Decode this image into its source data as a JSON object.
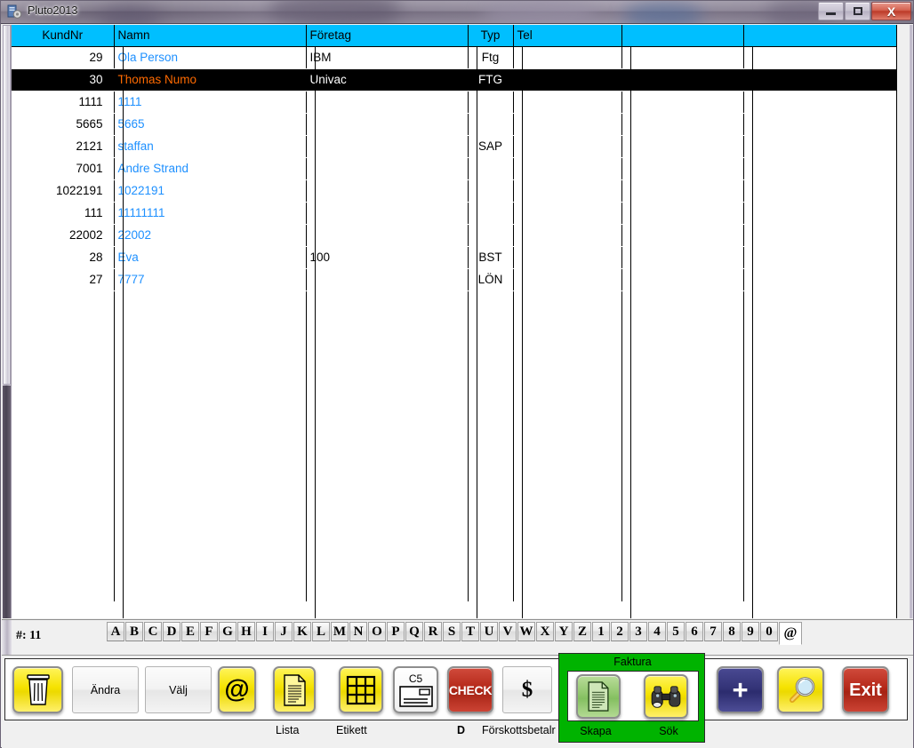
{
  "window": {
    "title": "Pluto2013",
    "icon": "app-icon",
    "controls": {
      "minimize": "minimize-icon",
      "maximize": "maximize-icon",
      "close": "X"
    }
  },
  "colors": {
    "header_blue": "#00bfff",
    "selected_row_bg": "#000000",
    "selected_row_text": "#ff6a00",
    "link_text": "#1e90ff",
    "faktura_green": "#00b300",
    "button_yellow": "#f5e200",
    "button_red": "#b5291a",
    "button_blue": "#343478"
  },
  "grid": {
    "columns": [
      {
        "key": "kundnr",
        "label": "KundNr"
      },
      {
        "key": "namn",
        "label": "Namn"
      },
      {
        "key": "foretag",
        "label": "Företag"
      },
      {
        "key": "typ",
        "label": "Typ"
      },
      {
        "key": "tel",
        "label": "Tel"
      },
      {
        "key": "extra1",
        "label": ""
      },
      {
        "key": "extra2",
        "label": ""
      }
    ],
    "rows": [
      {
        "kundnr": "29",
        "namn": "Ola Person",
        "foretag": "IBM",
        "typ": "Ftg",
        "tel": "",
        "extra1": "",
        "extra2": "",
        "selected": false
      },
      {
        "kundnr": "30",
        "namn": "Thomas Numo",
        "foretag": "Univac",
        "typ": "FTG",
        "tel": "",
        "extra1": "",
        "extra2": "",
        "selected": true
      },
      {
        "kundnr": "1111",
        "namn": "1111",
        "foretag": "",
        "typ": "",
        "tel": "",
        "extra1": "",
        "extra2": "",
        "selected": false
      },
      {
        "kundnr": "5665",
        "namn": "5665",
        "foretag": "",
        "typ": "",
        "tel": "",
        "extra1": "",
        "extra2": "",
        "selected": false
      },
      {
        "kundnr": "2121",
        "namn": "staffan",
        "foretag": "",
        "typ": "SAP",
        "tel": "",
        "extra1": "",
        "extra2": "",
        "selected": false
      },
      {
        "kundnr": "7001",
        "namn": "Andre Strand",
        "foretag": "",
        "typ": "",
        "tel": "",
        "extra1": "",
        "extra2": "",
        "selected": false
      },
      {
        "kundnr": "1022191",
        "namn": "1022191",
        "foretag": "",
        "typ": "",
        "tel": "",
        "extra1": "",
        "extra2": "",
        "selected": false
      },
      {
        "kundnr": "111",
        "namn": "11111111",
        "foretag": "",
        "typ": "",
        "tel": "",
        "extra1": "",
        "extra2": "",
        "selected": false
      },
      {
        "kundnr": "22002",
        "namn": "22002",
        "foretag": "",
        "typ": "",
        "tel": "",
        "extra1": "",
        "extra2": "",
        "selected": false
      },
      {
        "kundnr": "28",
        "namn": "Eva",
        "foretag": "100",
        "typ": "BST",
        "tel": "",
        "extra1": "",
        "extra2": "",
        "selected": false
      },
      {
        "kundnr": "27",
        "namn": "7777",
        "foretag": "",
        "typ": "LÖN",
        "tel": "",
        "extra1": "",
        "extra2": "",
        "selected": false
      }
    ]
  },
  "alphabar": {
    "count_label": "#: 11",
    "tabs": [
      "A",
      "B",
      "C",
      "D",
      "E",
      "F",
      "G",
      "H",
      "I",
      "J",
      "K",
      "L",
      "M",
      "N",
      "O",
      "P",
      "Q",
      "R",
      "S",
      "T",
      "U",
      "V",
      "W",
      "X",
      "Y",
      "Z",
      "1",
      "2",
      "3",
      "4",
      "5",
      "6",
      "7",
      "8",
      "9",
      "0",
      "@"
    ],
    "active_tab": "@"
  },
  "toolbar": {
    "buttons": [
      {
        "name": "delete",
        "icon": "trash-icon",
        "label": "",
        "style": "yellow"
      },
      {
        "name": "andra",
        "icon": "",
        "text": "Ändra",
        "label": "",
        "style": "flat"
      },
      {
        "name": "valj",
        "icon": "",
        "text": "Välj",
        "label": "",
        "style": "flat"
      },
      {
        "name": "email",
        "icon": "at-icon",
        "text": "@",
        "label": "",
        "style": "yellow"
      },
      {
        "name": "lista",
        "icon": "document-icon",
        "label": "Lista",
        "style": "yellow"
      },
      {
        "name": "etikett",
        "icon": "grid-icon",
        "label": "Etikett",
        "style": "yellow"
      },
      {
        "name": "c5",
        "icon": "envelope-icon",
        "text": "C5",
        "label": "",
        "style": "white"
      },
      {
        "name": "check",
        "icon": "check-icon",
        "text": "CHECK",
        "label": "D",
        "style": "red"
      },
      {
        "name": "forskott",
        "icon": "dollar-icon",
        "text": "$",
        "label": "Förskottsbetalr",
        "style": "flat"
      }
    ],
    "faktura": {
      "title": "Faktura",
      "create": {
        "label": "Skapa",
        "icon": "document-icon"
      },
      "search": {
        "label": "Sök",
        "icon": "binoculars-icon"
      }
    },
    "add": {
      "icon": "plus-icon",
      "text": "+"
    },
    "find": {
      "icon": "magnifier-icon"
    },
    "exit": {
      "icon": "exit-icon",
      "text": "Exit"
    }
  }
}
